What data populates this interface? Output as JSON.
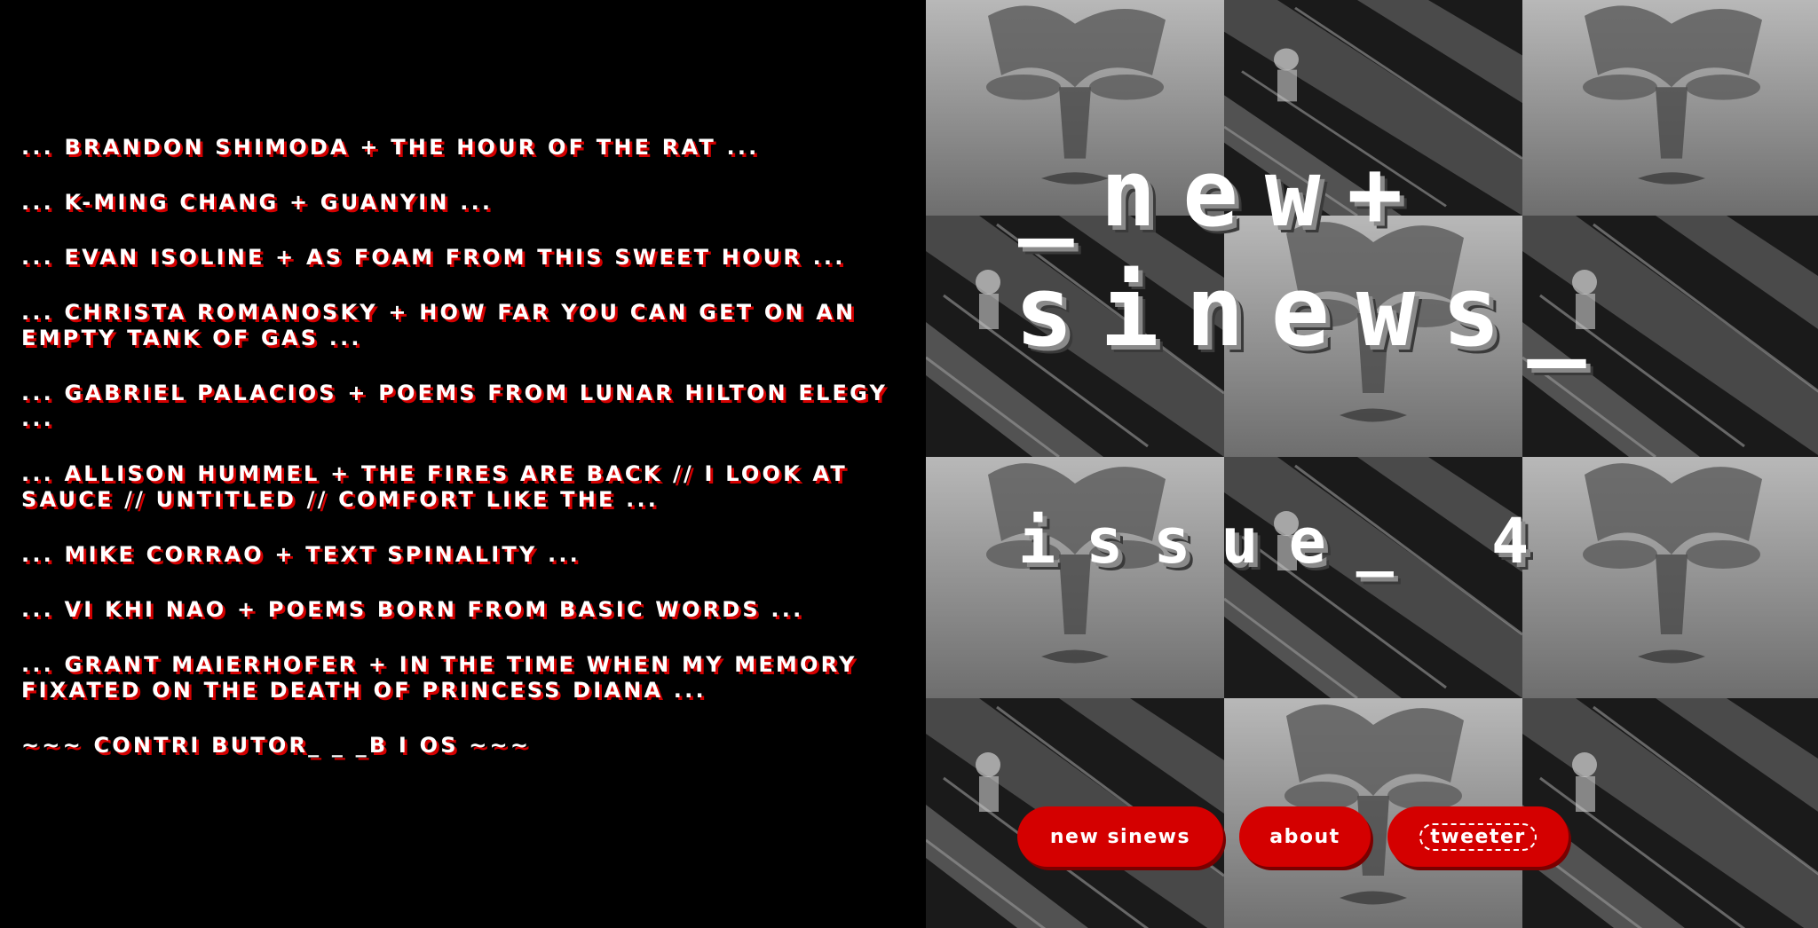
{
  "toc": {
    "items": [
      "... BRANDON SHIMODA + THE HOUR OF THE RAT ...",
      "... K-MING CHANG + GUANYIN ...",
      "... EVAN ISOLINE + AS FOAM FROM THIS SWEET HOUR ...",
      "... CHRISTA ROMANOSKY + HOW FAR YOU CAN GET ON AN EMPTY TANK OF GAS ...",
      "... GABRIEL PALACIOS + POEMS FROM LUNAR HILTON ELEGY ...",
      "... ALLISON HUMMEL + THE FIRES ARE BACK // I LOOK AT SAUCE // UNTITLED // COMFORT LIKE THE ...",
      "... MIKE CORRAO + TEXT SPINALITY ...",
      "... VI KHI NAO + POEMS BORN FROM BASIC WORDS ...",
      "... GRANT MAIERHOFER + IN THE TIME WHEN MY MEMORY FIXATED ON THE DEATH OF PRINCESS DIANA ...",
      "~~~ CONTRI BUTOR_ _ _B I OS ~~~"
    ]
  },
  "hero": {
    "title_line1": "_new+",
    "title_line2": "sinews_",
    "issue": "issue_ 4"
  },
  "nav": {
    "new_sinews": "new sinews",
    "about": "about",
    "tweeter": "tweeter"
  },
  "colors": {
    "accent": "#d40000",
    "background": "#000000",
    "text": "#ffffff"
  }
}
